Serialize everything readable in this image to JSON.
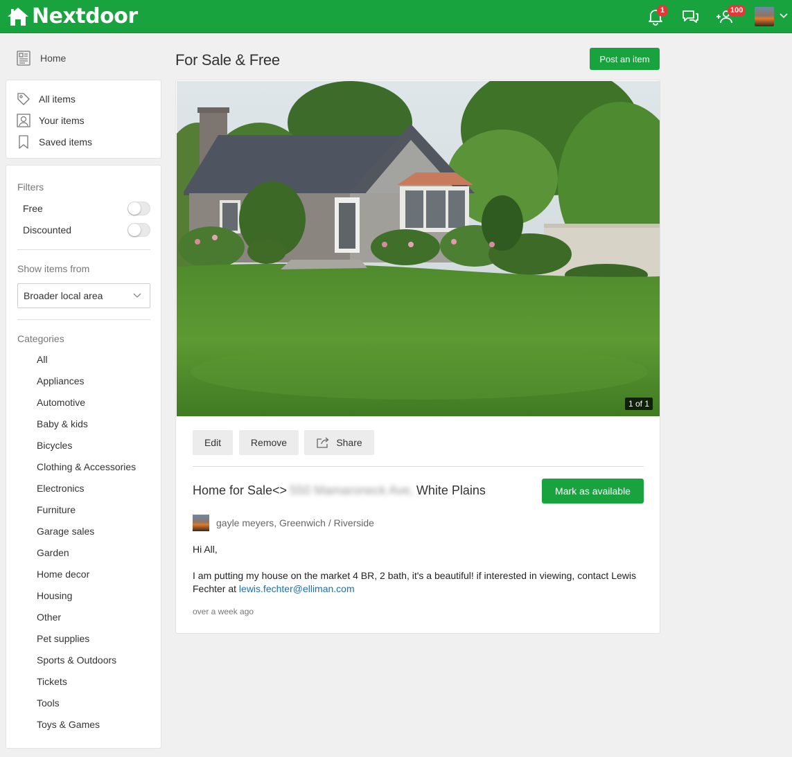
{
  "header": {
    "logo_text": "Nextdoor",
    "notifications_count": "1",
    "invites_count": "100",
    "brand_color": "#19a33f",
    "badge_color": "#e23838"
  },
  "sidebar": {
    "home_label": "Home",
    "nav_items": [
      {
        "label": "All items",
        "icon": "tag-icon"
      },
      {
        "label": "Your items",
        "icon": "person-icon"
      },
      {
        "label": "Saved items",
        "icon": "bookmark-icon"
      }
    ],
    "filters_label": "Filters",
    "filters": [
      {
        "label": "Free",
        "enabled": false
      },
      {
        "label": "Discounted",
        "enabled": false
      }
    ],
    "show_items_label": "Show items from",
    "show_items_value": "Broader local area",
    "categories_label": "Categories",
    "categories": [
      "All",
      "Appliances",
      "Automotive",
      "Baby & kids",
      "Bicycles",
      "Clothing & Accessories",
      "Electronics",
      "Furniture",
      "Garage sales",
      "Garden",
      "Home decor",
      "Housing",
      "Other",
      "Pet supplies",
      "Sports & Outdoors",
      "Tickets",
      "Tools",
      "Toys & Games"
    ]
  },
  "main": {
    "page_title": "For Sale & Free",
    "post_button": "Post an item",
    "photo_counter": "1 of 1",
    "actions": {
      "edit": "Edit",
      "remove": "Remove",
      "share": "Share"
    },
    "item": {
      "title_prefix": "Home for Sale<>",
      "title_blurred": "550 Mamaroneck Ave,",
      "title_suffix": "White Plains",
      "mark_available": "Mark as available",
      "author": "gayle meyers, Greenwich / Riverside",
      "greeting": "Hi All,",
      "body": "I am putting my house on the market 4 BR, 2 bath, it's a beautiful! if interested in viewing, contact Lewis Fechter at",
      "email": "lewis.fechter@elliman.com",
      "posted": "over a week ago"
    }
  }
}
